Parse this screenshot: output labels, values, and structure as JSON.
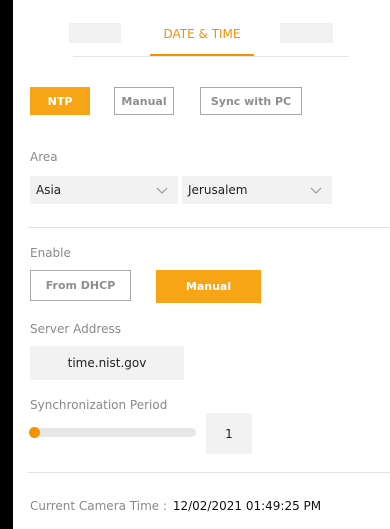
{
  "tabs": {
    "active_label": "DATE & TIME"
  },
  "mode_buttons": {
    "ntp": "NTP",
    "manual": "Manual",
    "sync_pc": "Sync with PC"
  },
  "area": {
    "label": "Area",
    "region_value": "Asia",
    "city_value": "Jerusalem"
  },
  "enable": {
    "label": "Enable",
    "from_dhcp": "From DHCP",
    "manual": "Manual"
  },
  "server": {
    "label": "Server Address",
    "value": "time.nist.gov"
  },
  "sync": {
    "label": "Synchronization Period",
    "value": "1",
    "slider_fraction": 0.02
  },
  "camera_time": {
    "label": "Current Camera Time :",
    "value": "12/02/2021 01:49:25 PM"
  },
  "colors": {
    "accent": "#f39200",
    "button_active": "#f7a417"
  },
  "icons": {
    "dropdown": "chevron-down-icon"
  }
}
